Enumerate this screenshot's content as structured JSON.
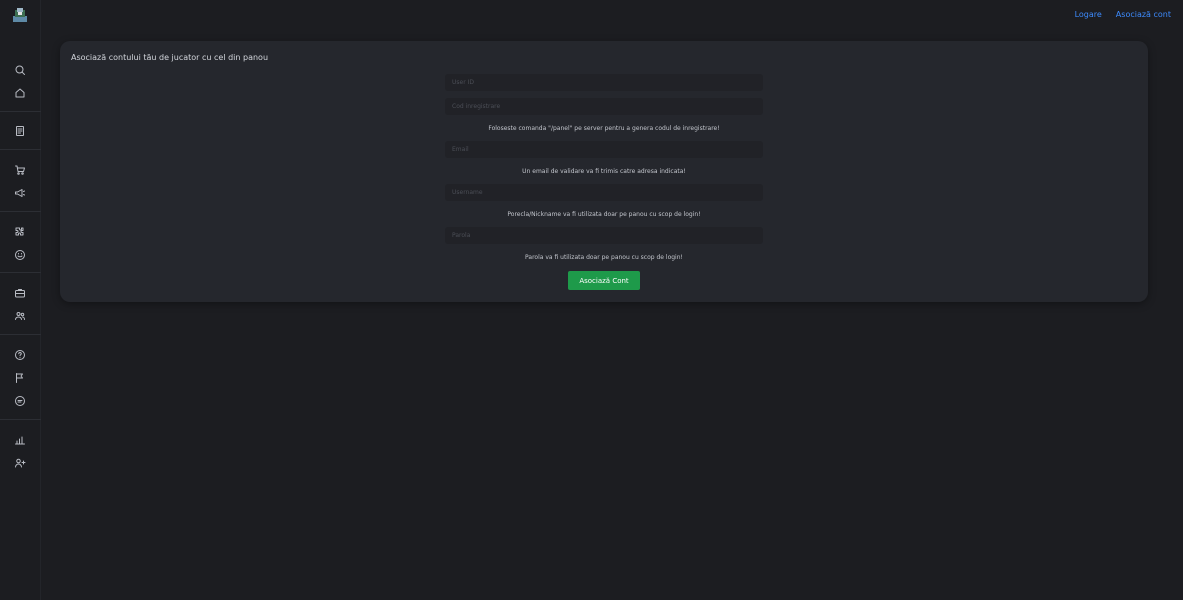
{
  "header": {
    "links": [
      {
        "label": "Logare"
      },
      {
        "label": "Asociază cont"
      }
    ]
  },
  "sidebar": {
    "icons": [
      "search-icon",
      "home-icon",
      "document-icon",
      "cart-icon",
      "megaphone-icon",
      "puzzle-icon",
      "smile-icon",
      "briefcase-icon",
      "users-icon",
      "help-icon",
      "flag-icon",
      "chat-icon",
      "chart-icon",
      "user-plus-icon"
    ]
  },
  "form": {
    "title": "Asociază contului tău de jucator cu cel din panou",
    "user_id_placeholder": "User ID",
    "code_placeholder": "Cod inregistrare",
    "code_hint": "Foloseste comanda \"/panel\" pe server pentru a genera codul de inregistrare!",
    "email_placeholder": "Email",
    "email_hint": "Un email de validare va fi trimis catre adresa indicata!",
    "username_placeholder": "Username",
    "username_hint": "Porecla/Nickname va fi utilizata doar pe panou cu scop de login!",
    "password_placeholder": "Parola",
    "password_hint": "Parola va fi utilizata doar pe panou cu scop de login!",
    "submit_label": "Asociază Cont"
  },
  "colors": {
    "background": "#1c1d21",
    "card": "#25272d",
    "link": "#3d8bfd",
    "button": "#1e9a4a"
  }
}
